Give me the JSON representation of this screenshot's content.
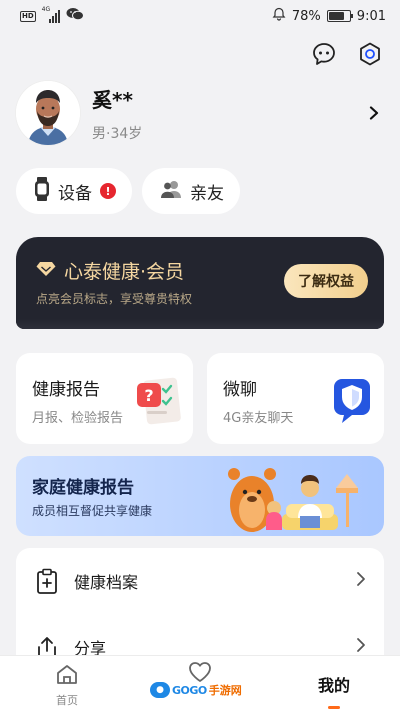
{
  "status_bar": {
    "hd": "HD",
    "network": "4G",
    "battery_percent": "78%",
    "battery_level": 0.78,
    "time": "9:01"
  },
  "header": {
    "icons": [
      "chat-bubble-icon",
      "settings-hexagon-icon"
    ]
  },
  "profile": {
    "name": "奚**",
    "meta": "男·34岁"
  },
  "chips": [
    {
      "label": "设备",
      "badge": "!"
    },
    {
      "label": "亲友"
    }
  ],
  "vip": {
    "title": "心泰健康·会员",
    "subtitle": "点亮会员标志，享受尊贵特权",
    "button": "了解权益"
  },
  "cards": [
    {
      "title": "健康报告",
      "subtitle": "月报、检验报告"
    },
    {
      "title": "微聊",
      "subtitle": "4G亲友聊天"
    }
  ],
  "family_banner": {
    "title": "家庭健康报告",
    "subtitle": "成员相互督促共享健康"
  },
  "menu": [
    {
      "label": "健康档案",
      "icon": "clipboard-plus-icon"
    },
    {
      "label": "分享",
      "icon": "share-icon"
    }
  ],
  "tabbar": {
    "home": "首页",
    "mine": "我的",
    "watermark_left": "GOGO",
    "watermark_right": "手游网"
  },
  "colors": {
    "accent": "#ff6a1a",
    "vip_gold": "#f5d7a1",
    "alert": "#e6262f"
  }
}
